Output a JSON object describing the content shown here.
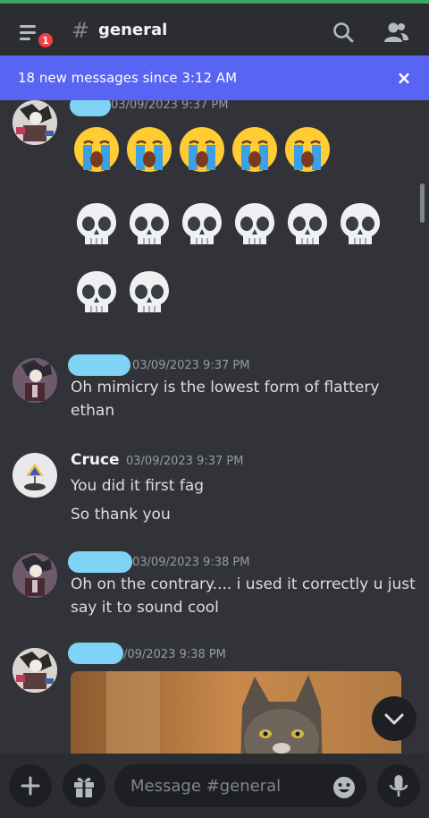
{
  "header": {
    "unread_badge": "1",
    "hash_symbol": "#",
    "channel_name": "general"
  },
  "banner": {
    "text": "18 new messages since 3:12 AM",
    "close_label": "×"
  },
  "messages": [
    {
      "author": "",
      "timestamp": "03/09/2023 9:37 PM",
      "emoji_rows": [
        [
          "😭",
          "😭",
          "😭",
          "😭",
          "😭"
        ],
        [
          "💀",
          "💀",
          "💀",
          "💀",
          "💀",
          "💀"
        ],
        [
          "💀",
          "💀"
        ]
      ]
    },
    {
      "author": "",
      "timestamp": "03/09/2023 9:37 PM",
      "lines": [
        "Oh mimicry is the lowest form of flattery ethan"
      ]
    },
    {
      "author": "Cruce",
      "timestamp": "03/09/2023 9:37 PM",
      "lines": [
        "You did it first fag",
        "So thank you"
      ]
    },
    {
      "author": "",
      "timestamp": "03/09/2023 9:38 PM",
      "lines": [
        "Oh on the contrary.... i used it correctly u just say it to sound cool"
      ]
    },
    {
      "author": "",
      "timestamp": "/09/2023 9:38 PM",
      "attachment": "cat-image"
    }
  ],
  "composer": {
    "placeholder": "Message #general"
  },
  "icons": {
    "menu": "hamburger-menu-icon",
    "search": "search-icon",
    "members": "members-icon",
    "plus": "plus-icon",
    "gift": "gift-icon",
    "emoji": "emoji-icon",
    "mic": "microphone-icon",
    "jump": "chevron-down-icon"
  },
  "colors": {
    "background": "#313338",
    "header": "#2b2d31",
    "banner": "#5865f2",
    "badge": "#f23f42",
    "redaction": "#7fd3f5"
  }
}
